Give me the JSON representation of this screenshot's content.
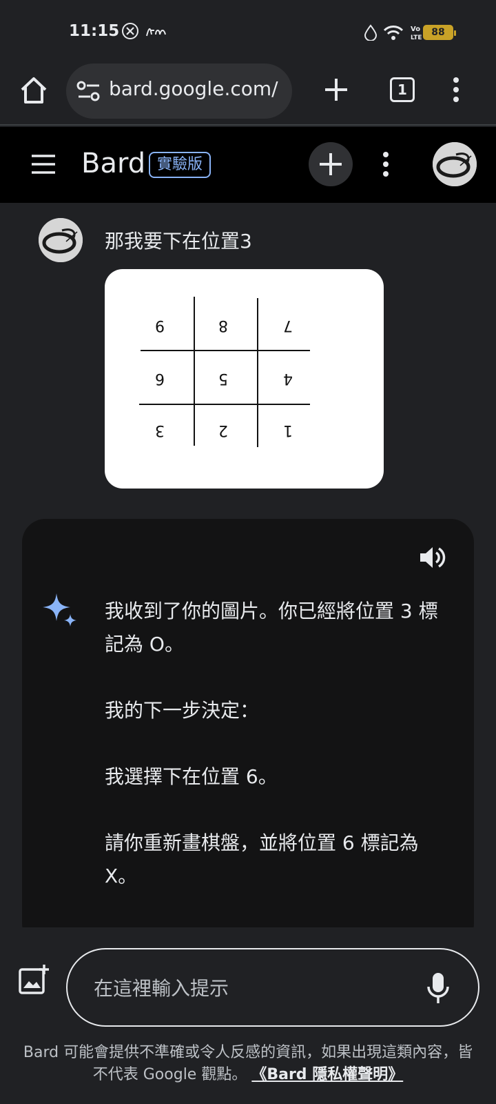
{
  "status_bar": {
    "time": "11:15",
    "battery": "88",
    "lte_label": "LTE",
    "icons": [
      "x-app-icon",
      "tend-app-icon",
      "droplet-icon",
      "wifi-icon",
      "volte-icon",
      "signal-icon",
      "battery-icon"
    ]
  },
  "browser": {
    "url": "bard.google.com/",
    "tab_count": "1"
  },
  "header": {
    "brand": "Bard",
    "badge": "實驗版"
  },
  "conversation": {
    "user_message": "那我要下在位置3",
    "board_cells": [
      "9",
      "8",
      "7",
      "6",
      "5",
      "4",
      "3",
      "2",
      "1"
    ],
    "bard_paragraphs": [
      "我收到了你的圖片。你已經將位置 3 標記為 O。",
      "我的下一步決定：",
      "我選擇下在位置 6。",
      "請你重新畫棋盤，並將位置 6 標記為 X。"
    ]
  },
  "input": {
    "placeholder": "在這裡輸入提示"
  },
  "footer": {
    "disclaimer": "Bard 可能會提供不準確或令人反感的資訊，如果出現這類內容，皆不代表 Google 觀點。",
    "privacy_link": "《Bard 隱私權聲明》"
  },
  "colors": {
    "background": "#202124",
    "header_bg": "#000000",
    "card_bg": "#131314",
    "accent": "#8ab4f8",
    "battery": "#c9a227"
  }
}
